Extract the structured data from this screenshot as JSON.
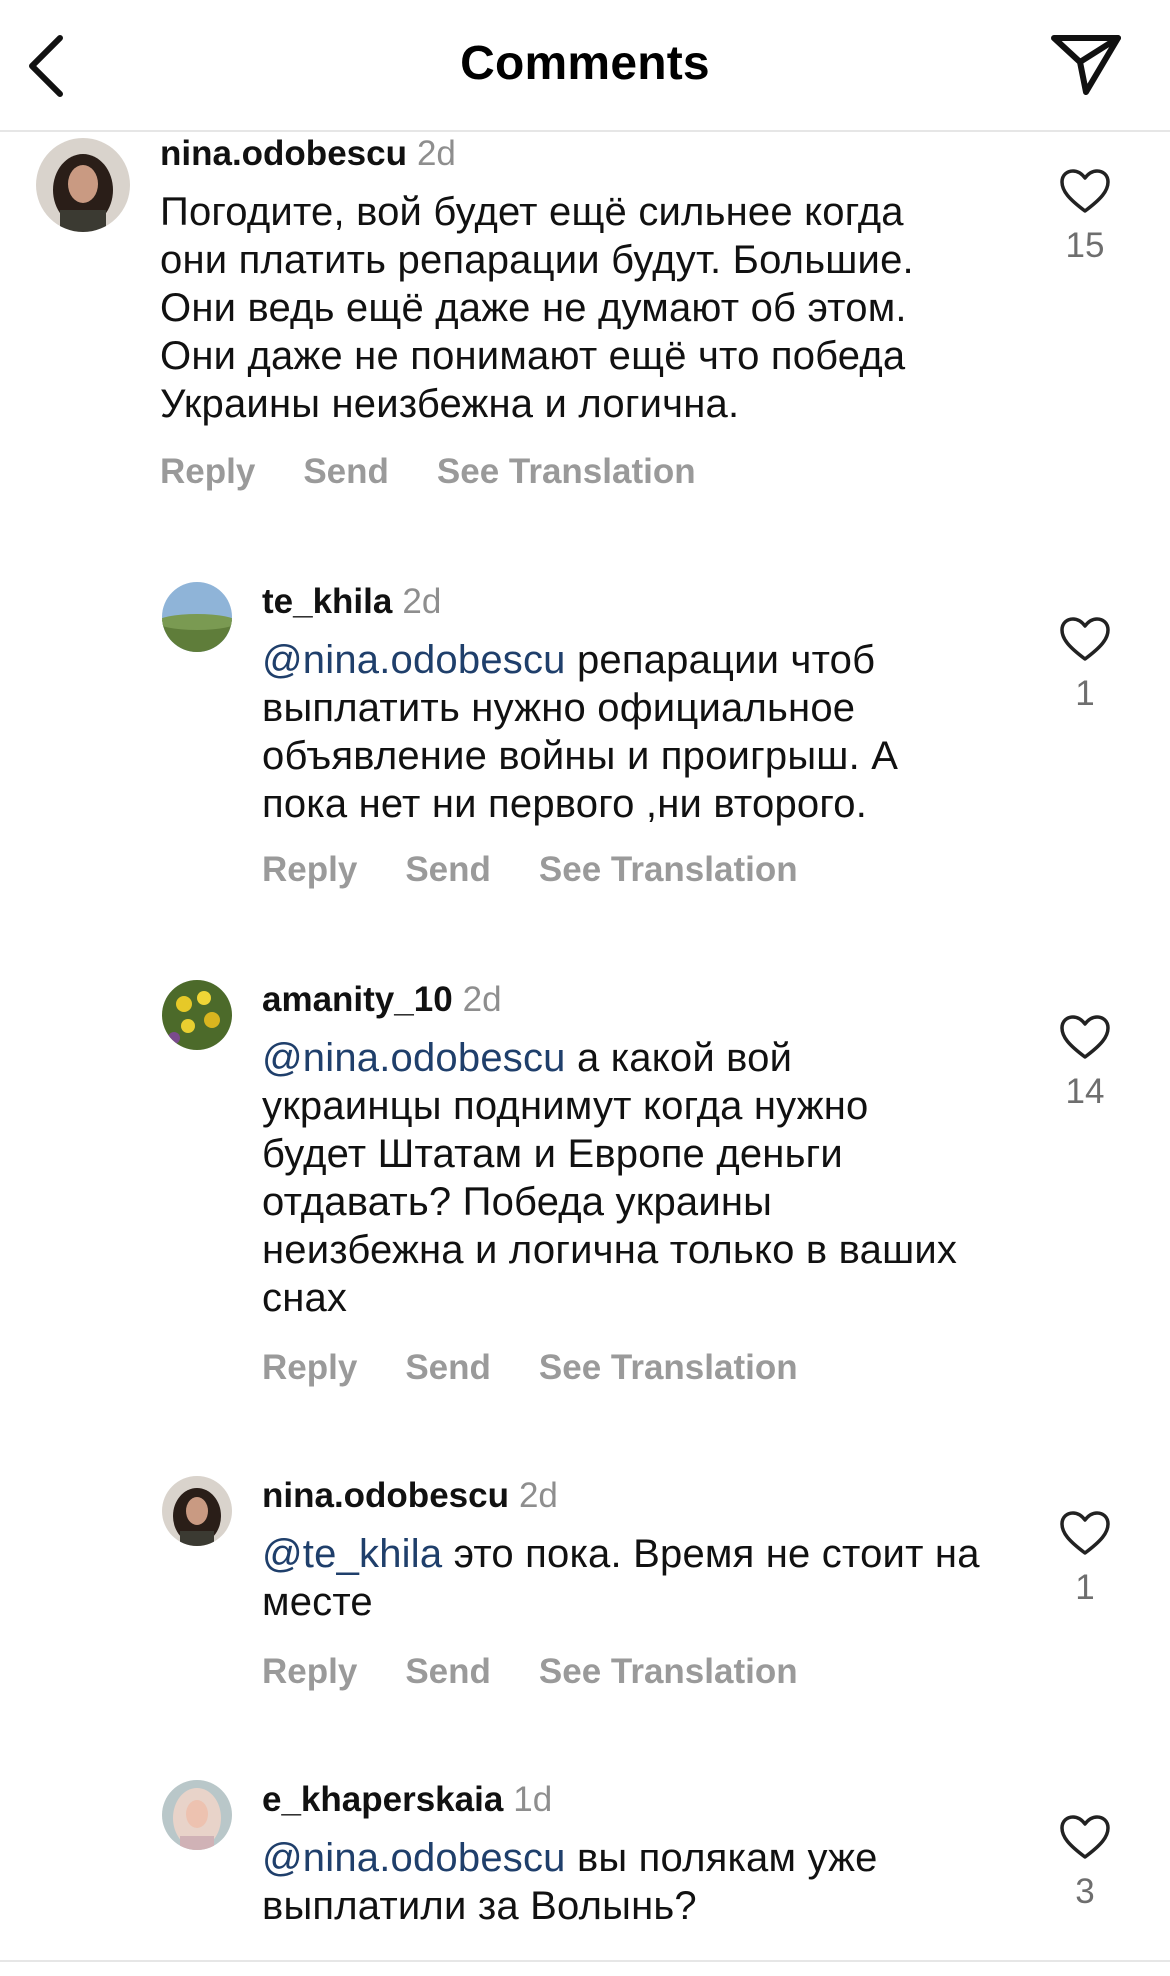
{
  "header": {
    "title": "Comments"
  },
  "actions": {
    "reply": "Reply",
    "send": "Send",
    "translate": "See Translation"
  },
  "comments": [
    {
      "username": "nina.odobescu",
      "time": "2d",
      "mention": "",
      "text": "Погодите, вой будет ещё сильнее когда они платить репарации будут. Большие. Они ведь ещё даже не думают об этом. Они даже не понимают ещё что победа Украины неизбежна и логична.",
      "likes": "15"
    },
    {
      "username": "te_khila",
      "time": "2d",
      "mention": "@nina.odobescu",
      "text": " репарации чтоб выплатить нужно официальное объявление войны и проигрыш. А пока нет ни первого ,ни второго.",
      "likes": "1"
    },
    {
      "username": "amanity_10",
      "time": "2d",
      "mention": "@nina.odobescu",
      "text": " а какой вой украинцы поднимут когда нужно будет Штатам и Европе деньги отдавать? Победа украины неизбежна и логична только в ваших снах",
      "likes": "14"
    },
    {
      "username": "nina.odobescu",
      "time": "2d",
      "mention": "@te_khila",
      "text": " это пока. Время не стоит на месте",
      "likes": "1"
    },
    {
      "username": "e_khaperskaia",
      "time": "1d",
      "mention": "@nina.odobescu",
      "text": " вы полякам уже выплатили за Волынь?",
      "likes": "3"
    }
  ]
}
